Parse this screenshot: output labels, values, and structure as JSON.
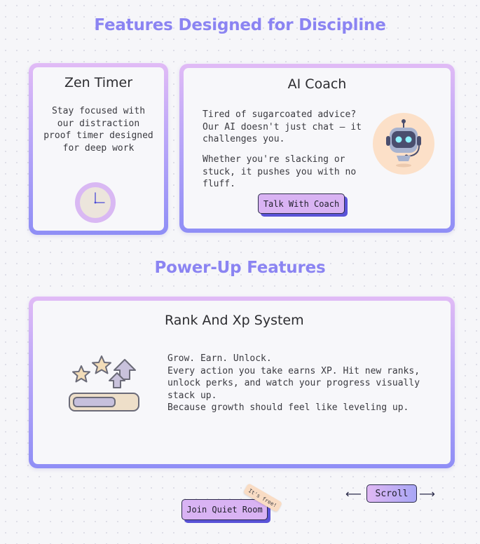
{
  "sections": {
    "features_title": "Features Designed for Discipline",
    "powerup_title": "Power-Up Features"
  },
  "zen_timer": {
    "title": "Zen Timer",
    "description": "Stay focused with our distraction proof timer designed for deep work",
    "icon": "clock-icon"
  },
  "ai_coach": {
    "title": "AI Coach",
    "paragraph1": "Tired of sugarcoated advice? Our AI doesn't just chat — it challenges you.",
    "paragraph2": "Whether you're slacking or stuck, it pushes you with no fluff.",
    "button_label": "Talk With Coach",
    "icon": "robot-headset-icon"
  },
  "rank_xp": {
    "title": "Rank And Xp System",
    "lines": [
      "Grow. Earn. Unlock.",
      "Every action you take earns XP. Hit new ranks, unlock perks, and watch your progress visually stack up.",
      "Because growth should feel like leveling up."
    ],
    "icon": "stars-level-up-icon",
    "progress_fraction": 0.6
  },
  "footer": {
    "join_button_label": "Join Quiet Room",
    "free_tag": "It's free!",
    "scroll_label": "Scroll",
    "scroll_left_arrow": "⟵",
    "scroll_right_arrow": "⟶"
  },
  "colors": {
    "accent": "#8b84f2",
    "button_fill": "#d9b3f3",
    "button_shadow": "#5a53d8",
    "card_gradient_top": "#e1bbf6",
    "card_gradient_bottom": "#8f8ef6"
  }
}
